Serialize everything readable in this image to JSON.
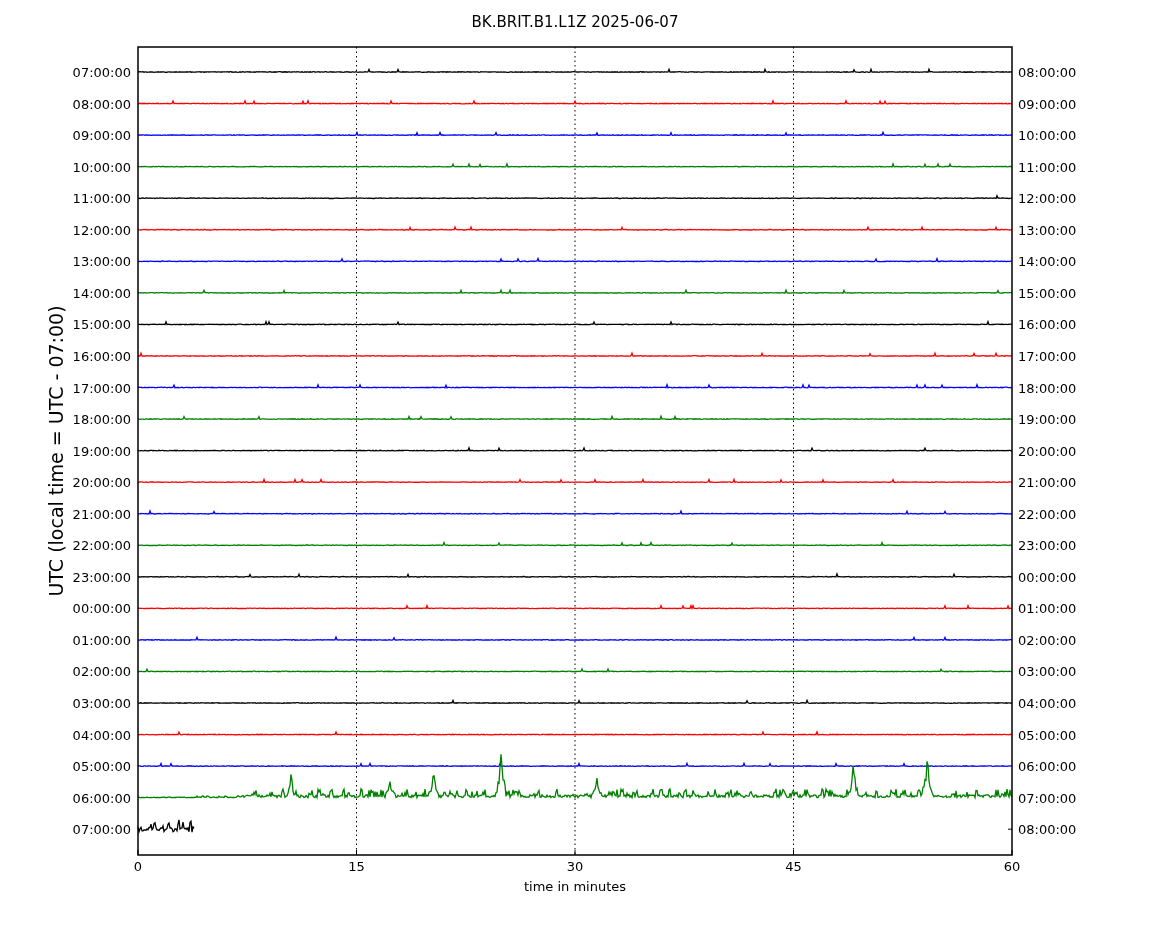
{
  "title": "BK.BRIT.B1.L1Z 2025-06-07",
  "ylabel": "UTC (local time = UTC - 07:00)",
  "xlabel": "time in minutes",
  "xticks": [
    "0",
    "15",
    "30",
    "45",
    "60"
  ],
  "rows": [
    {
      "left": "07:00:00",
      "right": "08:00:00",
      "color": "#000000",
      "kind": "quiet"
    },
    {
      "left": "08:00:00",
      "right": "09:00:00",
      "color": "#ff0000",
      "kind": "quiet"
    },
    {
      "left": "09:00:00",
      "right": "10:00:00",
      "color": "#0000ff",
      "kind": "quiet"
    },
    {
      "left": "10:00:00",
      "right": "11:00:00",
      "color": "#008000",
      "kind": "quiet"
    },
    {
      "left": "11:00:00",
      "right": "12:00:00",
      "color": "#000000",
      "kind": "quiet"
    },
    {
      "left": "12:00:00",
      "right": "13:00:00",
      "color": "#ff0000",
      "kind": "quiet"
    },
    {
      "left": "13:00:00",
      "right": "14:00:00",
      "color": "#0000ff",
      "kind": "quiet"
    },
    {
      "left": "14:00:00",
      "right": "15:00:00",
      "color": "#008000",
      "kind": "quiet"
    },
    {
      "left": "15:00:00",
      "right": "16:00:00",
      "color": "#000000",
      "kind": "quiet"
    },
    {
      "left": "16:00:00",
      "right": "17:00:00",
      "color": "#ff0000",
      "kind": "quiet"
    },
    {
      "left": "17:00:00",
      "right": "18:00:00",
      "color": "#0000ff",
      "kind": "quiet"
    },
    {
      "left": "18:00:00",
      "right": "19:00:00",
      "color": "#008000",
      "kind": "quiet"
    },
    {
      "left": "19:00:00",
      "right": "20:00:00",
      "color": "#000000",
      "kind": "quiet"
    },
    {
      "left": "20:00:00",
      "right": "21:00:00",
      "color": "#ff0000",
      "kind": "quiet"
    },
    {
      "left": "21:00:00",
      "right": "22:00:00",
      "color": "#0000ff",
      "kind": "quiet"
    },
    {
      "left": "22:00:00",
      "right": "23:00:00",
      "color": "#008000",
      "kind": "quiet"
    },
    {
      "left": "23:00:00",
      "right": "00:00:00",
      "color": "#000000",
      "kind": "quiet"
    },
    {
      "left": "00:00:00",
      "right": "01:00:00",
      "color": "#ff0000",
      "kind": "quiet"
    },
    {
      "left": "01:00:00",
      "right": "02:00:00",
      "color": "#0000ff",
      "kind": "quiet"
    },
    {
      "left": "02:00:00",
      "right": "03:00:00",
      "color": "#008000",
      "kind": "quiet"
    },
    {
      "left": "03:00:00",
      "right": "04:00:00",
      "color": "#000000",
      "kind": "quiet"
    },
    {
      "left": "04:00:00",
      "right": "05:00:00",
      "color": "#ff0000",
      "kind": "quiet"
    },
    {
      "left": "05:00:00",
      "right": "06:00:00",
      "color": "#0000ff",
      "kind": "quiet"
    },
    {
      "left": "06:00:00",
      "right": "07:00:00",
      "color": "#008000",
      "kind": "active"
    },
    {
      "left": "07:00:00",
      "right": "08:00:00",
      "color": "#000000",
      "kind": "partial"
    }
  ]
}
